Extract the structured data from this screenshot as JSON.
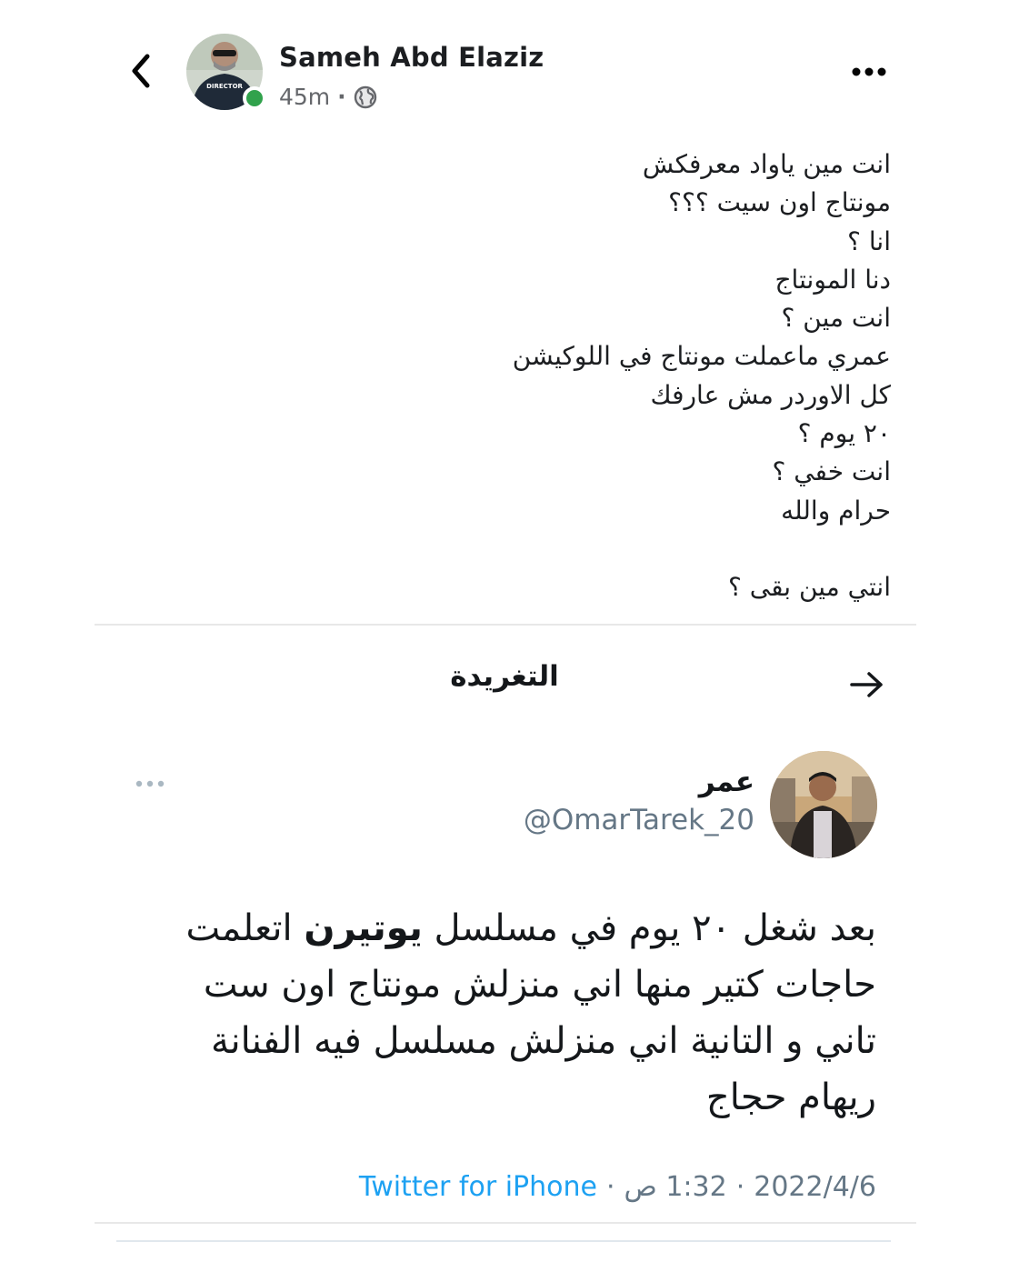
{
  "post": {
    "author_name": "Sameh Abd Elaziz",
    "time_ago": "45m",
    "separator": "·",
    "audience_icon": "globe-icon",
    "online_color": "#31a24c",
    "avatar_shirt_text": "DIRECTOR",
    "lines": [
      "انت مين ياواد معرفكش",
      "مونتاج اون سيت ؟؟؟",
      "انا ؟",
      "دنا المونتاج",
      "انت مين ؟",
      "عمري ماعملت مونتاج في اللوكيشن",
      "كل الاوردر مش عارفك",
      "٢٠ يوم ؟",
      "انت خفي ؟",
      "حرام والله",
      "",
      "انتي مين بقى ؟"
    ]
  },
  "tweet_section": {
    "title": "التغريدة",
    "arrow_icon": "arrow-right-icon"
  },
  "tweet": {
    "display_name": "عمر",
    "handle": "@OmarTarek_20",
    "text_before_bold": "بعد شغل ٢٠ يوم في مسلسل ",
    "text_bold": "يوتيرن",
    "text_after_bold": " اتعلمت حاجات كتير منها اني منزلش مونتاج اون ست تاني و التانية اني منزلش مسلسل فيه الفنانة ريهام حجاج",
    "date": "2022/4/6",
    "time": "1:32 ص",
    "source": "Twitter for iPhone",
    "separator": "·",
    "source_color": "#1da1f2"
  }
}
